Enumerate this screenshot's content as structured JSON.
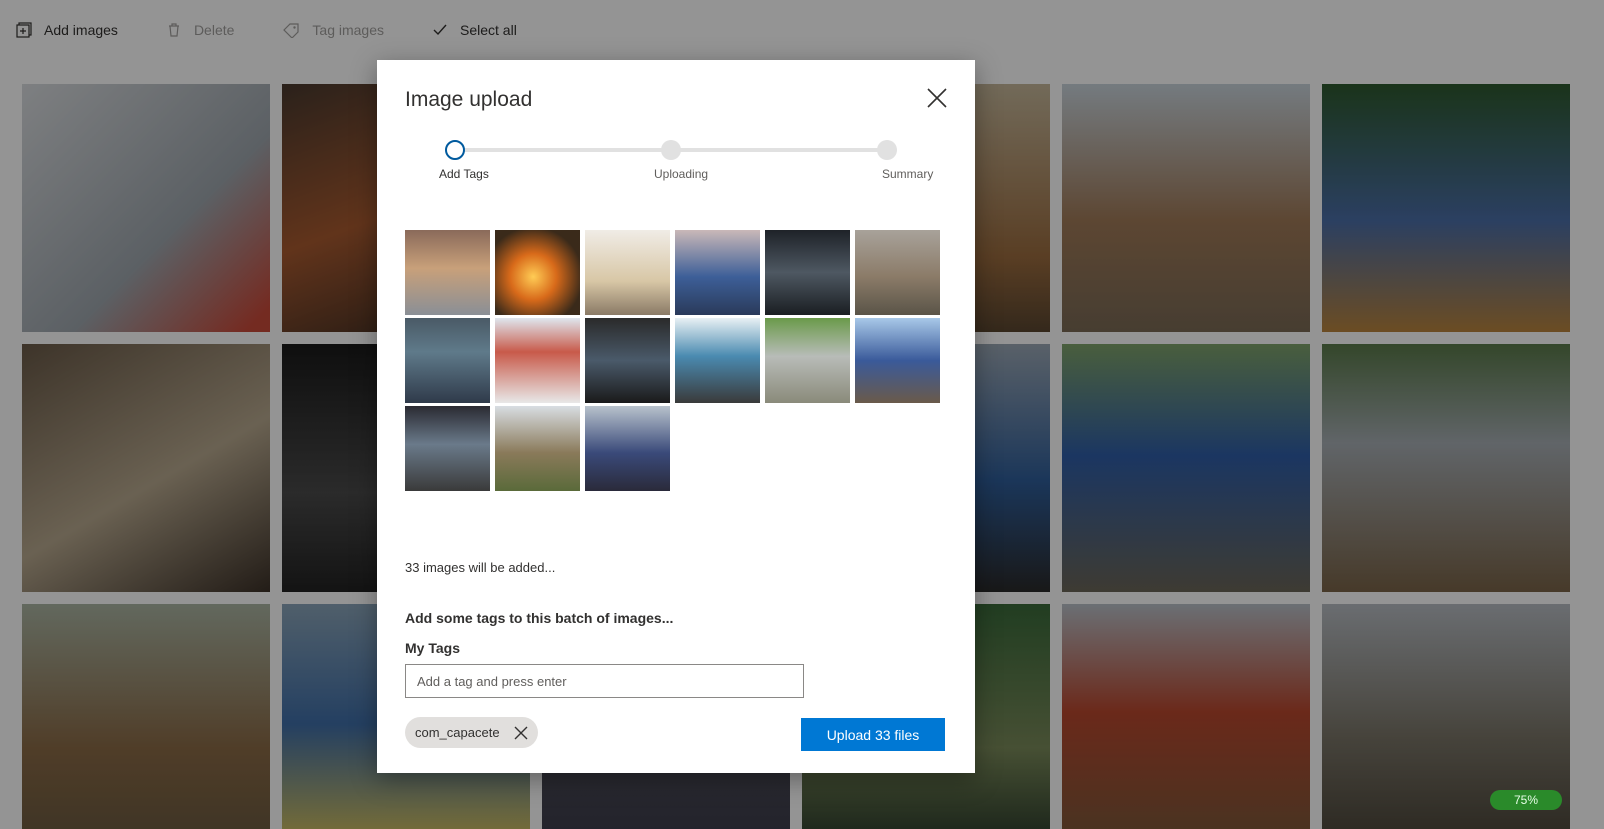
{
  "toolbar": {
    "add_images": "Add images",
    "delete": "Delete",
    "tag_images": "Tag images",
    "select_all": "Select all"
  },
  "dialog": {
    "title": "Image upload",
    "steps": [
      {
        "label": "Add Tags",
        "state": "active"
      },
      {
        "label": "Uploading",
        "state": "pending"
      },
      {
        "label": "Summary",
        "state": "pending"
      }
    ],
    "images_added_text": "33 images will be added...",
    "tags_prompt": "Add some tags to this batch of images...",
    "my_tags_label": "My Tags",
    "tag_input_placeholder": "Add a tag and press enter",
    "tags": [
      "com_capacete"
    ],
    "upload_button": "Upload 33 files"
  },
  "background_progress": "75%",
  "colors": {
    "accent": "#0078d4",
    "active_step": "#005a9e",
    "progress": "#2a8a2a",
    "overlay": "rgba(0,0,0,0.42)"
  },
  "icons": {
    "add_images": "add-image-icon",
    "delete": "trash-icon",
    "tag_images": "tag-icon",
    "select_all": "checkmark-icon",
    "close": "close-icon"
  }
}
